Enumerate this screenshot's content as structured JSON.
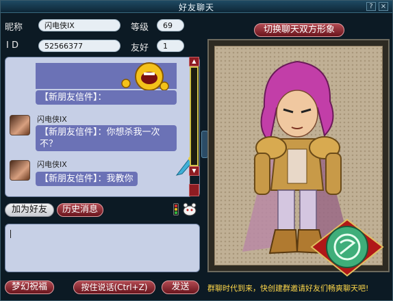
{
  "window": {
    "title": "好友聊天",
    "help": "?",
    "close": "×"
  },
  "profile": {
    "nickname_label": "昵称",
    "nickname": "闪电侠IX",
    "level_label": "等级",
    "level": "69",
    "id_label": "I D",
    "id": "52566377",
    "friendship_label": "友好",
    "friendship": "1"
  },
  "switch_view_button": "切换聊天双方形象",
  "chat": {
    "messages": [
      {
        "sender": "",
        "text": "【新朋友信件】："
      },
      {
        "sender": "闪电侠IX",
        "text": "【新朋友信件】：你想杀我一次不？"
      },
      {
        "sender": "闪电侠IX",
        "text": "【新朋友信件】：我教你"
      }
    ]
  },
  "buttons": {
    "add_friend": "加为好友",
    "history": "历史消息",
    "blessing": "梦幻祝福",
    "voice": "按住说话(Ctrl+Z)",
    "send": "发送"
  },
  "ticker": "群聊时代到来，快创建群邀请好友们畅爽聊天吧!",
  "icons": [
    "help-icon",
    "close-icon",
    "emoji-yellow-face",
    "traffic-light-icon",
    "pet-icon",
    "jade-medallion-icon",
    "scroll-up-icon",
    "scroll-down-icon"
  ],
  "colors": {
    "accent": "#8e1c22",
    "bubble": "#6b72b6",
    "ticker": "#ffd84a"
  }
}
